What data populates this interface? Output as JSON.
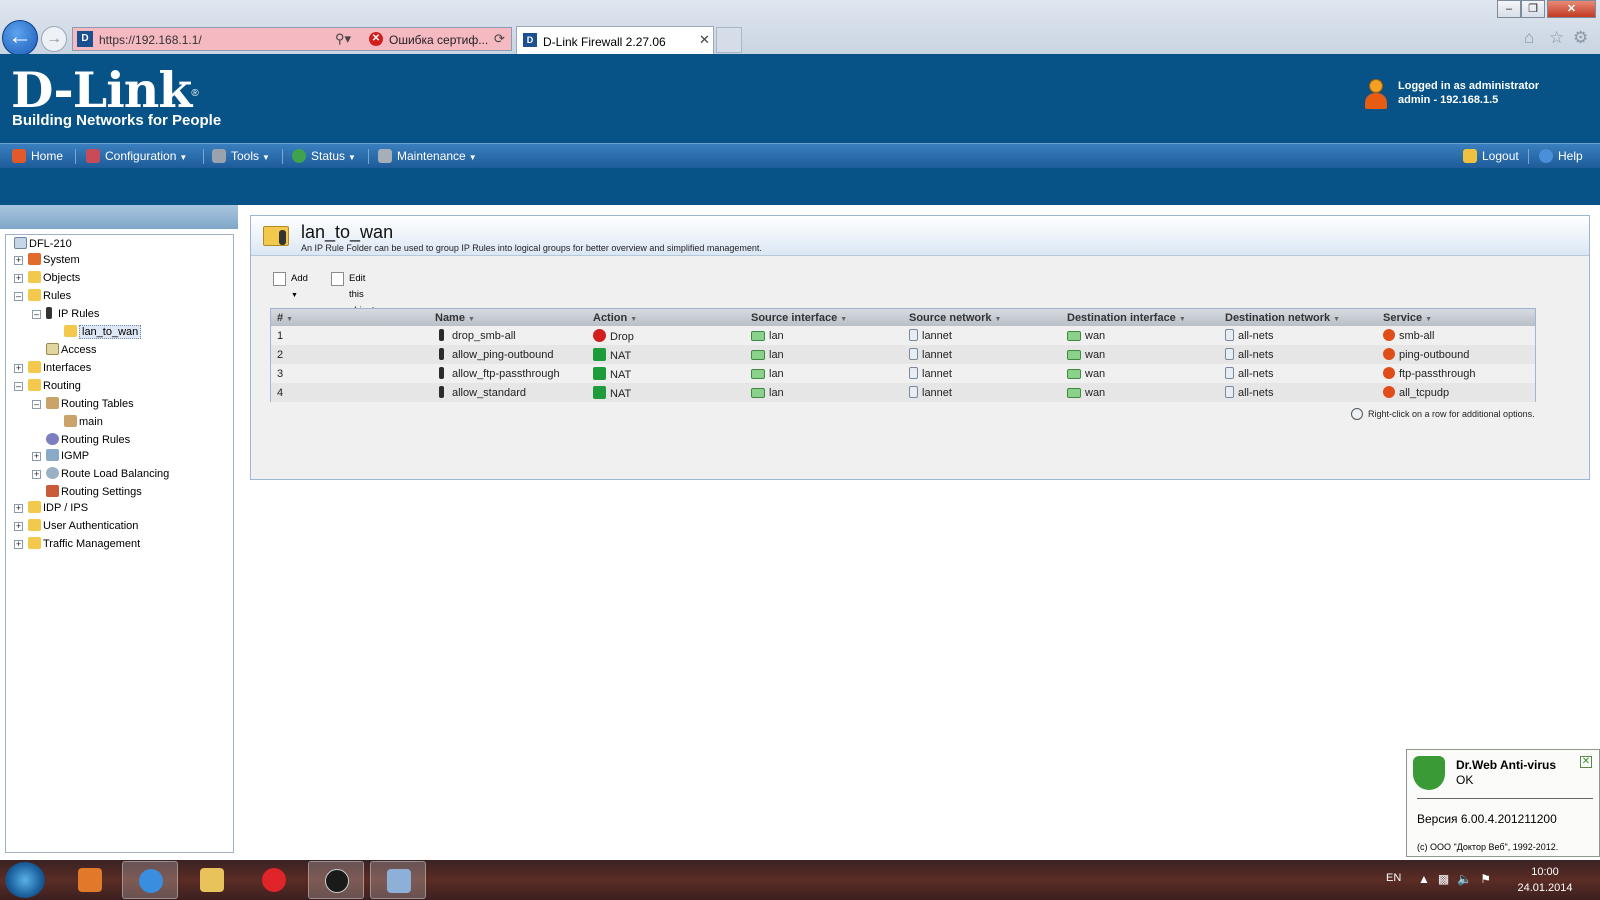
{
  "browser": {
    "url": "https://192.168.1.1/",
    "cert_error": "Ошибка сертиф...",
    "tab_title": "D-Link Firewall 2.27.06"
  },
  "header": {
    "logo_text": "D-Link",
    "tagline": "Building Networks for People",
    "logged_in_line1": "Logged in as administrator",
    "logged_in_line2": "admin - 192.168.1.5"
  },
  "nav": {
    "home": "Home",
    "configuration": "Configuration",
    "tools": "Tools",
    "status": "Status",
    "maintenance": "Maintenance",
    "logout": "Logout",
    "help": "Help"
  },
  "tree": {
    "root": "DFL-210",
    "system": "System",
    "objects": "Objects",
    "rules": "Rules",
    "ip_rules": "IP Rules",
    "lan_to_wan": "lan_to_wan",
    "access": "Access",
    "interfaces": "Interfaces",
    "routing": "Routing",
    "routing_tables": "Routing Tables",
    "main": "main",
    "routing_rules": "Routing Rules",
    "igmp": "IGMP",
    "route_load_balancing": "Route Load Balancing",
    "routing_settings": "Routing Settings",
    "idp_ips": "IDP / IPS",
    "user_authentication": "User Authentication",
    "traffic_management": "Traffic Management"
  },
  "panel": {
    "title": "lan_to_wan",
    "description": "An IP Rule Folder can be used to group IP Rules into logical groups for better overview and simplified management.",
    "add_label": "Add",
    "edit_label": "Edit this object",
    "hint": "Right-click on a row for additional options."
  },
  "table": {
    "columns": [
      "#",
      "Name",
      "Action",
      "Source interface",
      "Source network",
      "Destination interface",
      "Destination network",
      "Service"
    ],
    "rows": [
      {
        "num": "1",
        "name": "drop_smb-all",
        "action": "Drop",
        "src_if": "lan",
        "src_net": "lannet",
        "dst_if": "wan",
        "dst_net": "all-nets",
        "service": "smb-all"
      },
      {
        "num": "2",
        "name": "allow_ping-outbound",
        "action": "NAT",
        "src_if": "lan",
        "src_net": "lannet",
        "dst_if": "wan",
        "dst_net": "all-nets",
        "service": "ping-outbound"
      },
      {
        "num": "3",
        "name": "allow_ftp-passthrough",
        "action": "NAT",
        "src_if": "lan",
        "src_net": "lannet",
        "dst_if": "wan",
        "dst_net": "all-nets",
        "service": "ftp-passthrough"
      },
      {
        "num": "4",
        "name": "allow_standard",
        "action": "NAT",
        "src_if": "lan",
        "src_net": "lannet",
        "dst_if": "wan",
        "dst_net": "all-nets",
        "service": "all_tcpudp"
      }
    ]
  },
  "drweb": {
    "title": "Dr.Web Anti-virus",
    "status": "OK",
    "version": "Версия 6.00.4.201211200",
    "copyright": "(c) ООО \"Доктор Веб\", 1992-2012."
  },
  "taskbar": {
    "lang": "EN",
    "time": "10:00",
    "date": "24.01.2014"
  },
  "colors": {
    "brand_blue": "#075286",
    "nav_blue": "#2a6cab",
    "drop_red": "#d21e1e",
    "nat_green": "#1e9b3a"
  }
}
